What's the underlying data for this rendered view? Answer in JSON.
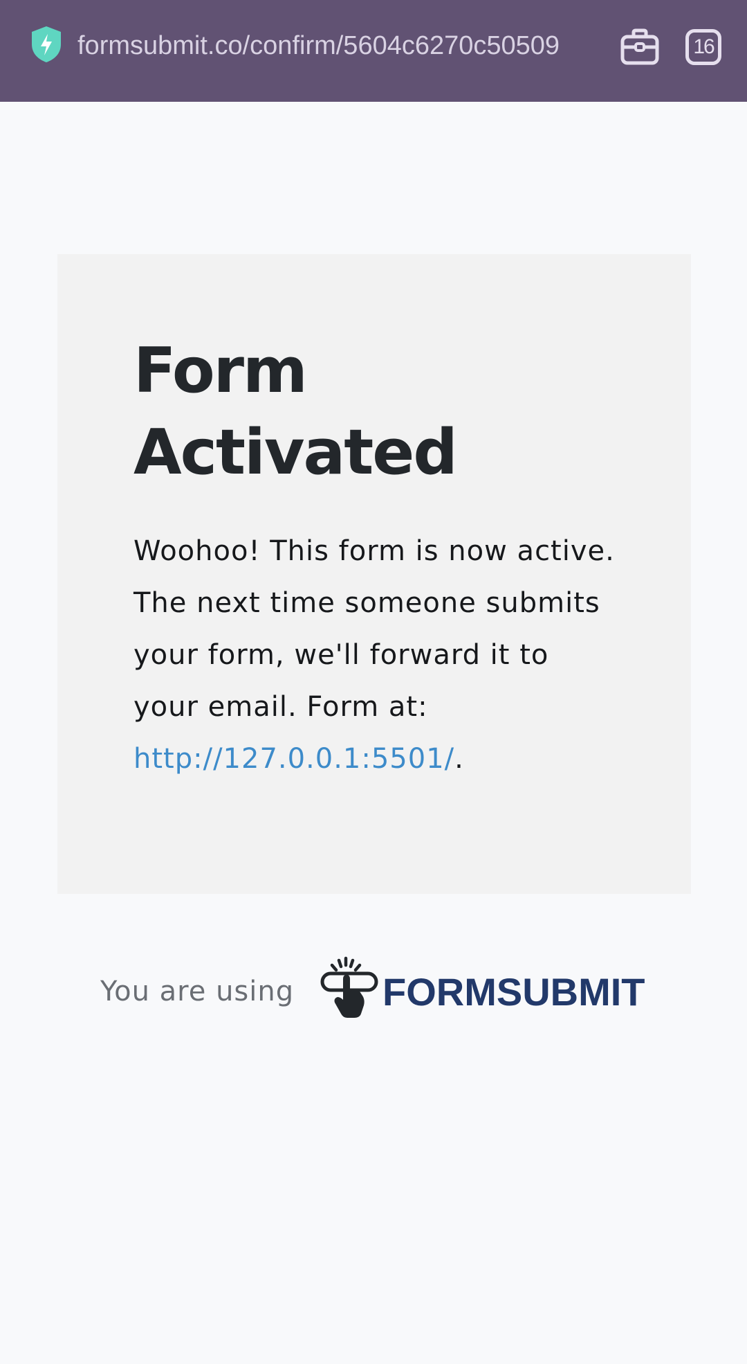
{
  "browser": {
    "url": "formsubmit.co/confirm/5604c6270c50509",
    "tab_count": "16",
    "icons": {
      "site_security": "shield-bolt-icon",
      "wallet": "briefcase-icon",
      "tabs": "tab-counter-icon"
    },
    "colors": {
      "toolbar_bg": "#615273",
      "shield": "#5fd6c1"
    }
  },
  "card": {
    "title": "Form Activated",
    "message_text": "Woohoo! This form is now active. The next time someone submits your form, we'll forward it to your email. Form at: ",
    "form_link": "http://127.0.0.1:5501/",
    "message_end": ".",
    "colors": {
      "background": "#f2f2f2",
      "link": "#3d8bca"
    }
  },
  "footer": {
    "using_text": "You are using",
    "brand_name": "FORMSUBMIT",
    "brand_icon": "pointing-hand-click-icon",
    "colors": {
      "brand": "#22396a"
    }
  }
}
